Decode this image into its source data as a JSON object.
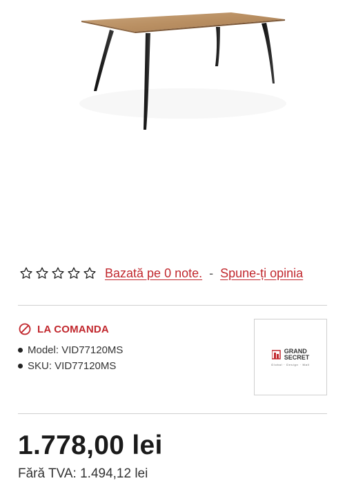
{
  "product": {
    "image_alt": "dining-table",
    "rating": {
      "stars_filled": 0,
      "stars_total": 5,
      "based_on_text": "Bazată pe 0 note.",
      "separator": "-",
      "review_link_text": "Spune-ți opinia"
    },
    "availability": {
      "label": "LA COMANDA",
      "icon": "block-icon",
      "color": "#c1272d"
    },
    "specs": {
      "model": "Model: VID77120MS",
      "sku": "SKU: VID77120MS"
    },
    "brand": {
      "name_line1": "GRAND",
      "name_line2": "SECRET",
      "tagline": "Global · Design · Mall",
      "accent": "#c1272d"
    },
    "price": {
      "gross": "1.778,00 lei",
      "net": "Fără TVA: 1.494,12 lei"
    }
  }
}
